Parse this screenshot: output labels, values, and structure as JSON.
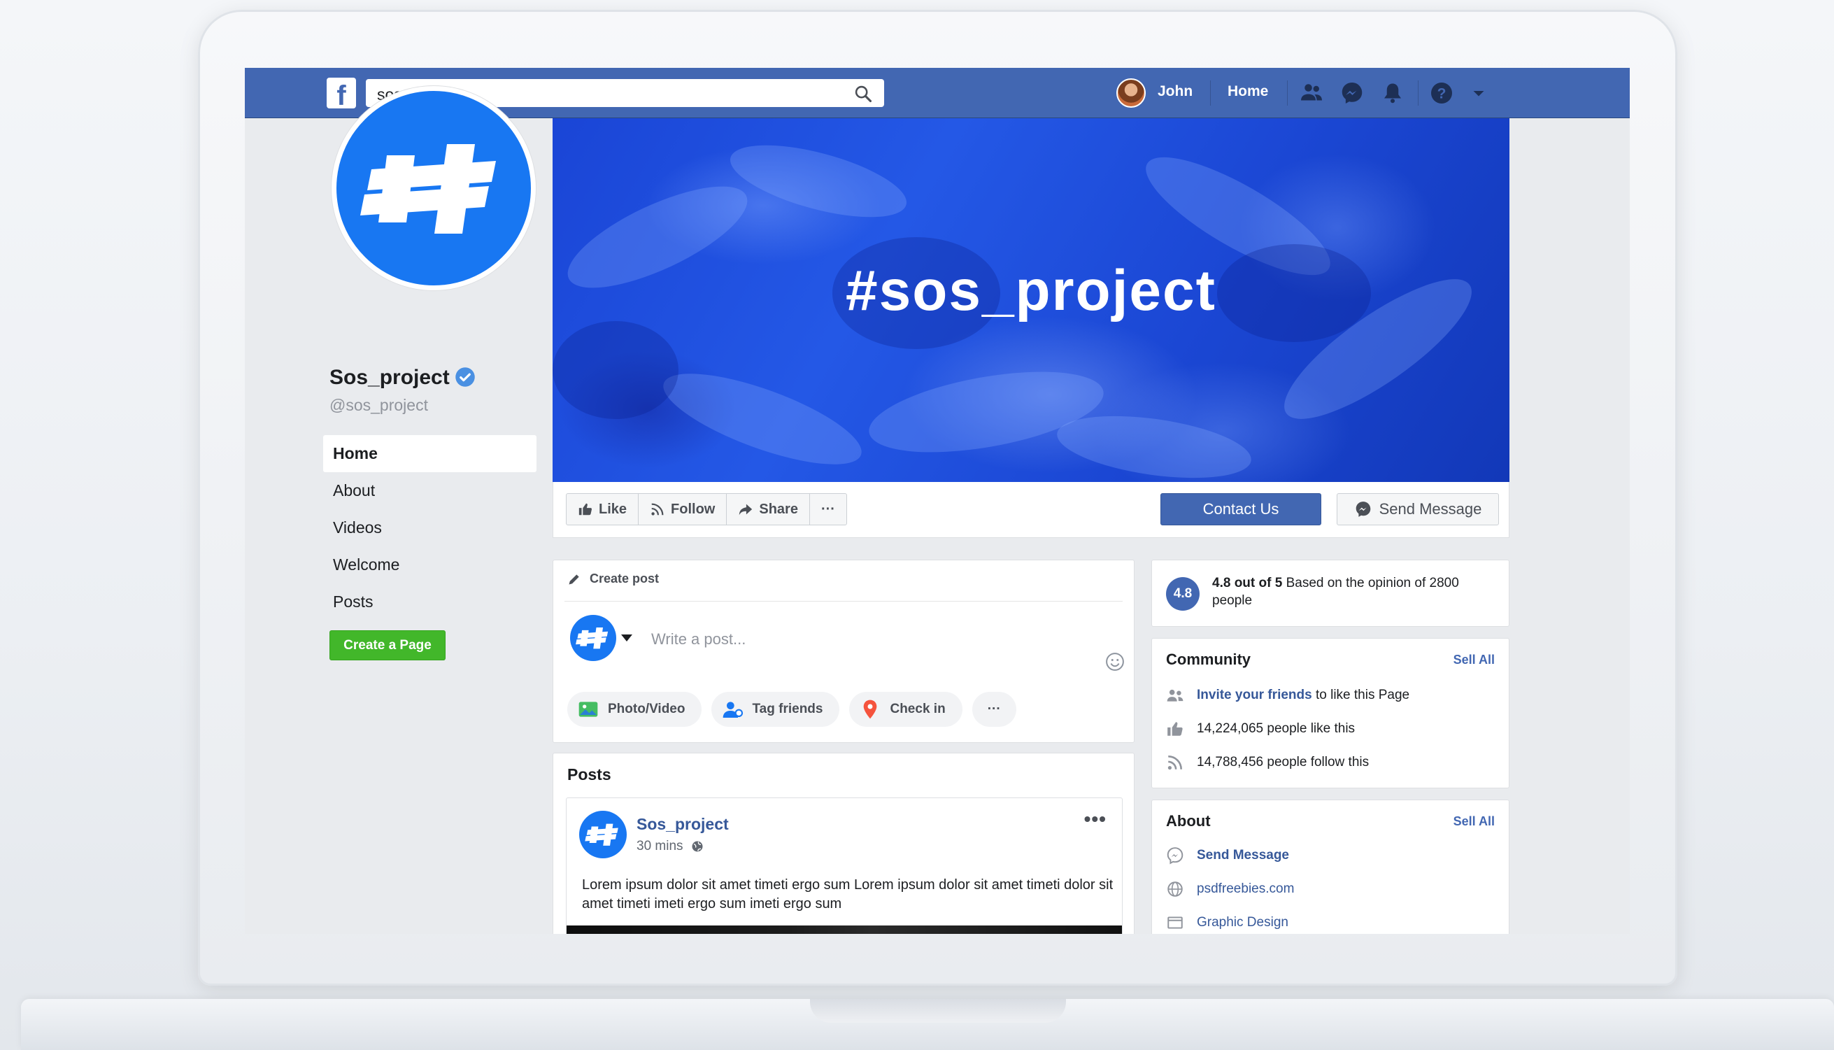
{
  "topbar": {
    "logo": "f",
    "search_value": "sos project",
    "user_name": "John",
    "home_label": "Home",
    "icons": [
      "friends-icon",
      "messenger-icon",
      "notifications-icon",
      "help-icon",
      "dropdown-caret-icon"
    ]
  },
  "cover": {
    "title": "#sos_project",
    "color": "#1f4fe0"
  },
  "profile": {
    "name": "Sos_project",
    "handle": "@sos_project",
    "brand_color": "#1877f2"
  },
  "sidebar": {
    "items": [
      {
        "label": "Home"
      },
      {
        "label": "About"
      },
      {
        "label": "Videos"
      },
      {
        "label": "Welcome"
      },
      {
        "label": "Posts"
      }
    ],
    "create_page_label": "Create a Page"
  },
  "actions": {
    "like_label": "Like",
    "follow_label": "Follow",
    "share_label": "Share",
    "more_label": "···",
    "contact_label": "Contact Us",
    "message_label": "Send Message"
  },
  "create_post": {
    "header": "Create post",
    "placeholder": "Write a post...",
    "chips": [
      {
        "label": "Photo/Video",
        "icon": "photo-icon"
      },
      {
        "label": "Tag friends",
        "icon": "tag-friends-icon"
      },
      {
        "label": "Check in",
        "icon": "check-in-icon"
      }
    ],
    "more_label": "···"
  },
  "posts": {
    "title": "Posts",
    "items": [
      {
        "author": "Sos_project",
        "time": "30 mins",
        "text": "Lorem ipsum dolor sit amet timeti ergo sum Lorem ipsum dolor sit amet timeti dolor sit amet timeti imeti ergo sum imeti ergo sum",
        "menu": "•••"
      }
    ]
  },
  "rating": {
    "badge": "4.8",
    "score_text": "4.8 out of 5",
    "detail_text": "Based  on the opinion of 2800 people"
  },
  "community": {
    "title": "Community",
    "see_all": "Sell All",
    "invite_link": "Invite your friends",
    "invite_rest": "to like this Page",
    "likes_text": "14,224,065 people like this",
    "follows_text": "14,788,456 people follow this"
  },
  "about": {
    "title": "About",
    "see_all": "Sell All",
    "send_message": "Send Message",
    "website": "psdfreebies.com",
    "category": "Graphic Design"
  },
  "colors": {
    "facebook_blue": "#4267b2",
    "link_blue": "#365899",
    "create_page_green": "#42b72a"
  }
}
